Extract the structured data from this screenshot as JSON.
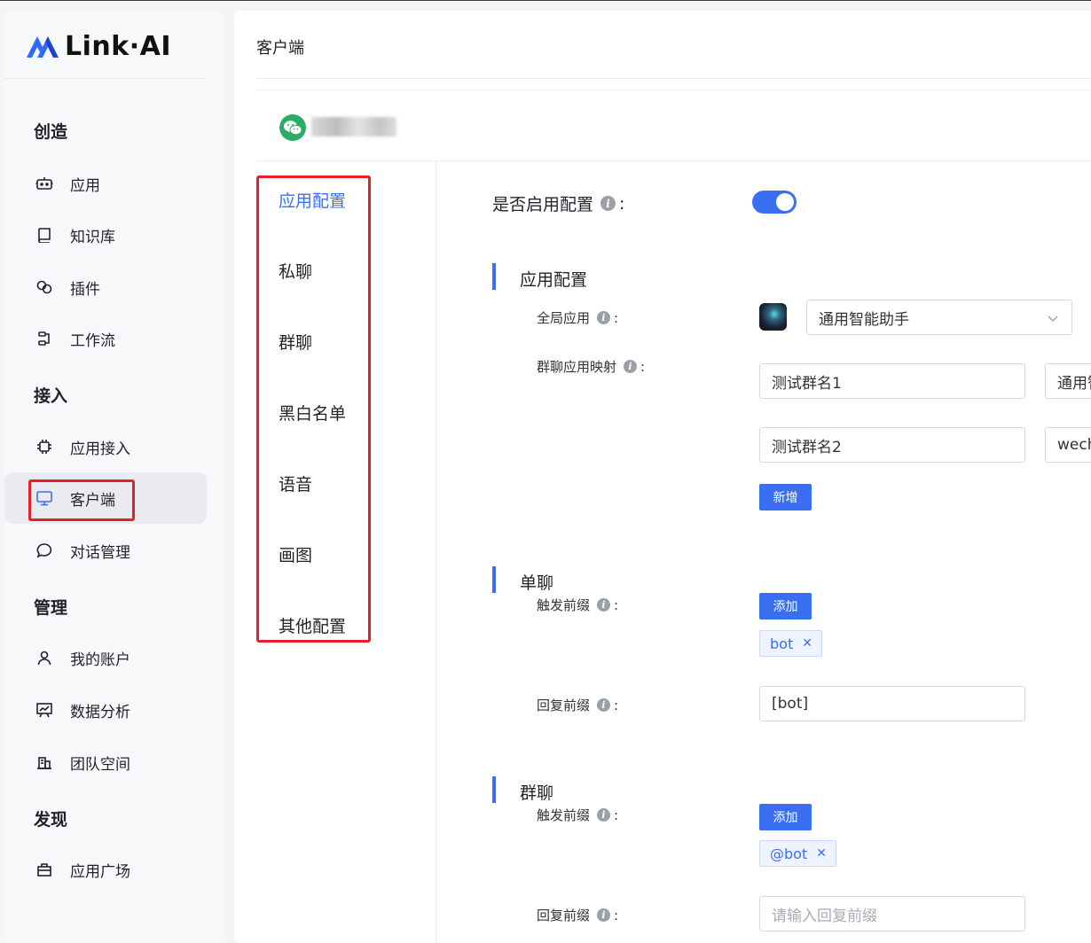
{
  "brand": {
    "name": "Link·AI"
  },
  "sidebar": {
    "sections": [
      {
        "title": "创造"
      },
      {
        "title": "接入"
      },
      {
        "title": "管理"
      },
      {
        "title": "发现"
      }
    ],
    "items": [
      {
        "label": "应用",
        "icon": "robot-icon"
      },
      {
        "label": "知识库",
        "icon": "book-icon"
      },
      {
        "label": "插件",
        "icon": "plugin-icon"
      },
      {
        "label": "工作流",
        "icon": "workflow-icon"
      },
      {
        "label": "应用接入",
        "icon": "chip-icon"
      },
      {
        "label": "客户端",
        "icon": "monitor-icon",
        "active": true
      },
      {
        "label": "对话管理",
        "icon": "chat-bubble-icon"
      },
      {
        "label": "我的账户",
        "icon": "user-icon"
      },
      {
        "label": "数据分析",
        "icon": "chart-board-icon"
      },
      {
        "label": "团队空间",
        "icon": "building-icon"
      },
      {
        "label": "应用广场",
        "icon": "shop-bag-icon"
      }
    ]
  },
  "main": {
    "title": "客户端",
    "client": {
      "icon": "wechat-icon",
      "name": "wechat-client"
    },
    "tabs": [
      {
        "label": "应用配置",
        "active": true
      },
      {
        "label": "私聊"
      },
      {
        "label": "群聊"
      },
      {
        "label": "黑白名单"
      },
      {
        "label": "语音"
      },
      {
        "label": "画图"
      },
      {
        "label": "其他配置"
      }
    ],
    "form": {
      "enable_label": "是否启用配置",
      "enable_value": true,
      "app_section": {
        "title": "应用配置",
        "global_app_label": "全局应用",
        "global_app_value": "通用智能助手",
        "group_map_label": "群聊应用映射",
        "mappings": [
          {
            "group": "测试群名1",
            "app": "通用智能助手"
          },
          {
            "group": "测试群名2",
            "app": "wechat"
          }
        ],
        "add_button": "新增"
      },
      "single_section": {
        "title": "单聊",
        "trigger_label": "触发前缀",
        "add_button": "添加",
        "tags": [
          "bot"
        ],
        "reply_label": "回复前缀",
        "reply_value": "[bot]"
      },
      "group_section": {
        "title": "群聊",
        "trigger_label": "触发前缀",
        "add_button": "添加",
        "tags": [
          "@bot"
        ],
        "reply_label": "回复前缀",
        "reply_placeholder": "请输入回复前缀"
      }
    }
  },
  "colors": {
    "accent": "#3a6ff2",
    "highlight_box": "#e5202a",
    "wechat": "#2aae67"
  }
}
